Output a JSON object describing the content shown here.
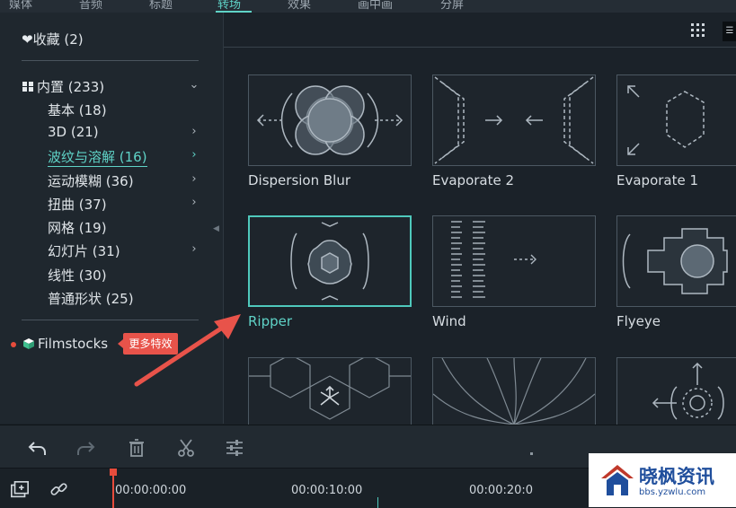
{
  "top_tabs": [
    {
      "label": "媒体"
    },
    {
      "label": "音频"
    },
    {
      "label": "标题"
    },
    {
      "label": "转场"
    },
    {
      "label": "效果"
    },
    {
      "label": "画中画"
    },
    {
      "label": "分屏"
    }
  ],
  "sidebar": {
    "favorites_label": "收藏 (2)",
    "builtin_label": "内置 (233)",
    "items": [
      {
        "label": "基本 (18)",
        "has_arrow": false
      },
      {
        "label": "3D (21)",
        "has_arrow": true
      },
      {
        "label": "波纹与溶解 (16)",
        "has_arrow": true
      },
      {
        "label": "运动模糊 (36)",
        "has_arrow": true
      },
      {
        "label": "扭曲 (37)",
        "has_arrow": true
      },
      {
        "label": "网格 (19)",
        "has_arrow": false
      },
      {
        "label": "幻灯片 (31)",
        "has_arrow": true
      },
      {
        "label": "线性 (30)",
        "has_arrow": false
      },
      {
        "label": "普通形状 (25)",
        "has_arrow": false
      }
    ],
    "filmstocks_label": "Filmstocks",
    "tooltip": "更多特效"
  },
  "transitions": [
    {
      "name": "Dispersion Blur"
    },
    {
      "name": "Evaporate 2"
    },
    {
      "name": "Evaporate 1"
    },
    {
      "name": "Ripper",
      "selected": true
    },
    {
      "name": "Wind"
    },
    {
      "name": "Flyeye"
    },
    {
      "name": ""
    },
    {
      "name": ""
    },
    {
      "name": ""
    }
  ],
  "timeline": {
    "timecodes": [
      "00:00:00:00",
      "00:00:10:00",
      "00:00:20:0"
    ]
  },
  "watermark": {
    "title": "晓枫资讯",
    "url": "bbs.yzwlu.com"
  },
  "colors": {
    "accent": "#5fd3c7",
    "tooltip": "#e8534a",
    "playhead": "#e74c3c",
    "background": "#1b2229"
  }
}
